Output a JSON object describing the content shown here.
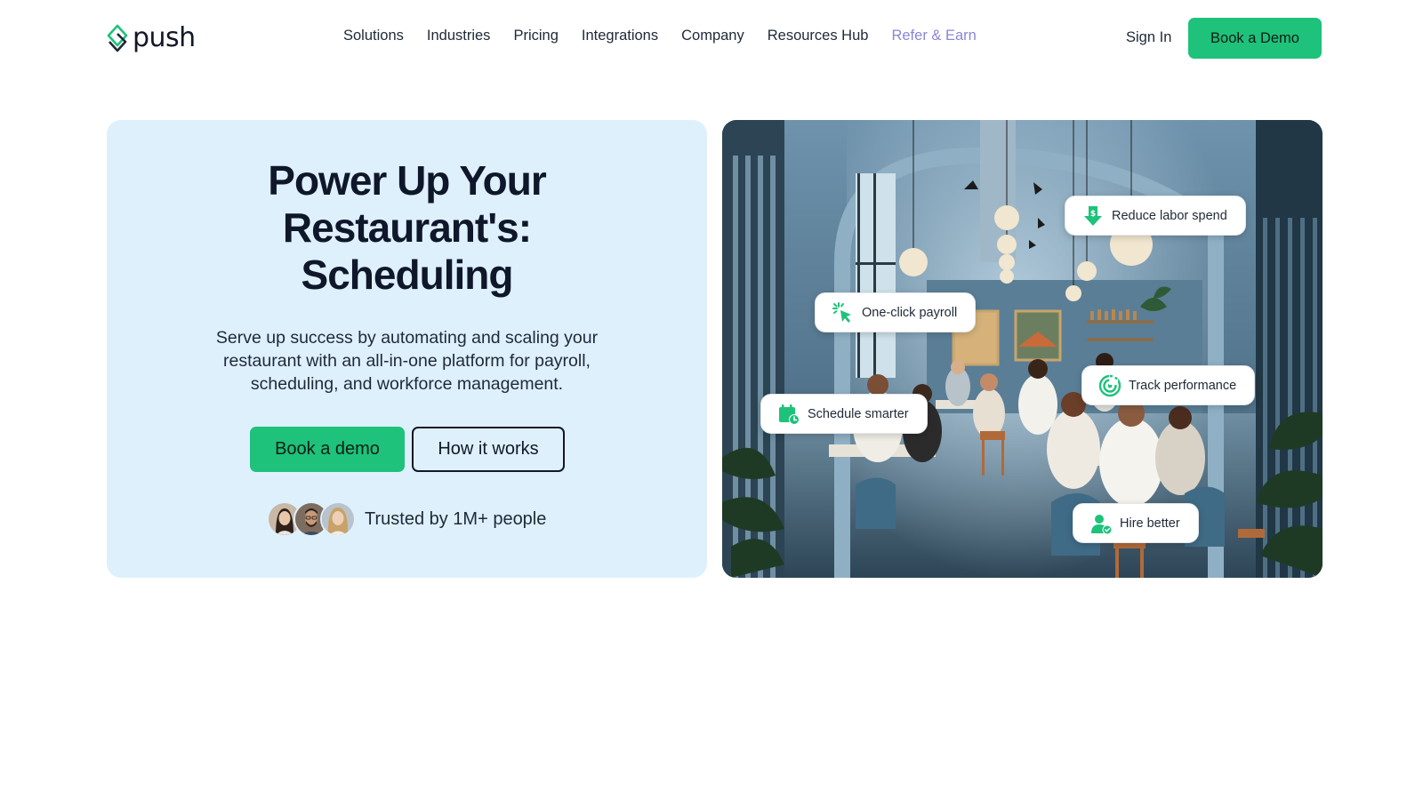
{
  "brand": {
    "name": "push",
    "accent": "#1ec27a",
    "refer_color": "#8b86d6",
    "hero_bg": "#dff0fd"
  },
  "nav": {
    "items": [
      {
        "label": "Solutions"
      },
      {
        "label": "Industries"
      },
      {
        "label": "Pricing"
      },
      {
        "label": "Integrations"
      },
      {
        "label": "Company"
      },
      {
        "label": "Resources Hub"
      },
      {
        "label": "Refer & Earn"
      }
    ],
    "sign_in": "Sign In",
    "demo_button": "Book a Demo"
  },
  "hero": {
    "title_lines": [
      "Power Up Your",
      "Restaurant's:",
      "Scheduling"
    ],
    "subtitle_lines": [
      "Serve up success by automating and scaling your",
      "restaurant with an all-in-one platform for payroll,",
      "scheduling, and workforce management."
    ],
    "primary_button": "Book a demo",
    "secondary_button": "How it works",
    "trust_text": "Trusted by 1M+ people"
  },
  "features": [
    {
      "label": "Reduce labor spend",
      "icon": "dollar-arrow-down-icon"
    },
    {
      "label": "One-click payroll",
      "icon": "cursor-click-icon"
    },
    {
      "label": "Track performance",
      "icon": "target-icon"
    },
    {
      "label": "Schedule smarter",
      "icon": "calendar-clock-icon"
    },
    {
      "label": "Hire better",
      "icon": "user-check-icon"
    }
  ]
}
